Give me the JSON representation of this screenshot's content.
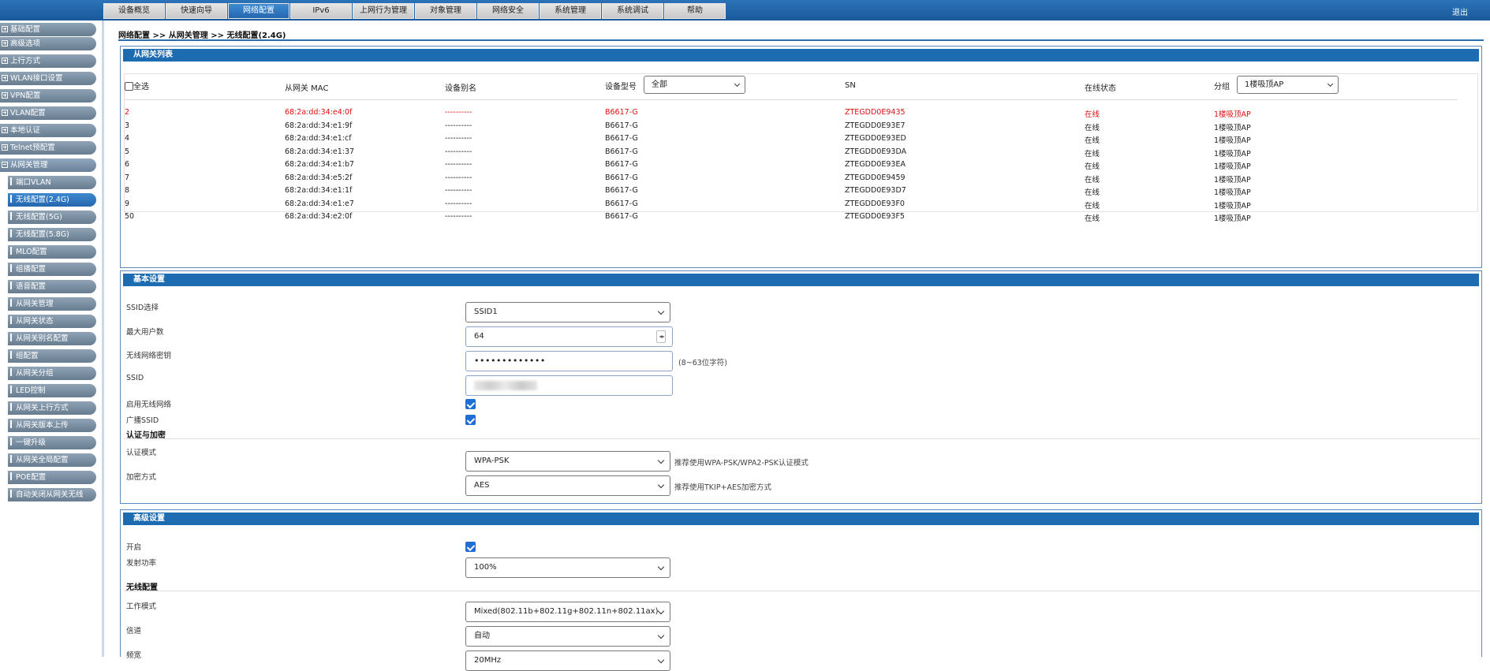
{
  "nav": {
    "tabs": [
      "设备概览",
      "快速向导",
      "网络配置",
      "IPv6",
      "上网行为管理",
      "对象管理",
      "网络安全",
      "系统管理",
      "系统调试",
      "帮助"
    ],
    "active_index": 2,
    "logout": "退出"
  },
  "sidebar": {
    "groups": [
      "基础配置",
      "高级选项",
      "上行方式",
      "WLAN接口设置",
      "VPN配置",
      "VLAN配置",
      "本地认证",
      "Telnet预配置",
      "从网关管理"
    ],
    "subitems": [
      "端口VLAN",
      "无线配置(2.4G)",
      "无线配置(5G)",
      "无线配置(5.8G)",
      "MLO配置",
      "组播配置",
      "语音配置",
      "从网关管理",
      "从网关状态",
      "从网关别名配置",
      "组配置",
      "从网关分组",
      "LED控制",
      "从网关上行方式",
      "从网关版本上传",
      "一键升级",
      "从网关全局配置",
      "POE配置",
      "自动关闭从网关无线"
    ],
    "current_sub": 1
  },
  "breadcrumb": "网络配置 >> 从网关管理 >> 无线配置(2.4G)",
  "list": {
    "title": "从网关列表",
    "headers": {
      "select_all": "全选",
      "mac": "从网关 MAC",
      "alias": "设备别名",
      "model": "设备型号",
      "sn": "SN",
      "status": "在线状态",
      "group": "分组"
    },
    "model_filter": "全部",
    "group_filter": "1楼吸顶AP",
    "rows": [
      {
        "id": "2",
        "mac": "68:2a:dd:34:e4:0f",
        "alias": "----------",
        "model": "B6617-G",
        "sn": "ZTEGDD0E9435",
        "status": "在线",
        "group": "1楼吸顶AP",
        "highlight": true
      },
      {
        "id": "3",
        "mac": "68:2a:dd:34:e1:9f",
        "alias": "----------",
        "model": "B6617-G",
        "sn": "ZTEGDD0E93E7",
        "status": "在线",
        "group": "1楼吸顶AP"
      },
      {
        "id": "4",
        "mac": "68:2a:dd:34:e1:cf",
        "alias": "----------",
        "model": "B6617-G",
        "sn": "ZTEGDD0E93ED",
        "status": "在线",
        "group": "1楼吸顶AP"
      },
      {
        "id": "5",
        "mac": "68:2a:dd:34:e1:37",
        "alias": "----------",
        "model": "B6617-G",
        "sn": "ZTEGDD0E93DA",
        "status": "在线",
        "group": "1楼吸顶AP"
      },
      {
        "id": "6",
        "mac": "68:2a:dd:34:e1:b7",
        "alias": "----------",
        "model": "B6617-G",
        "sn": "ZTEGDD0E93EA",
        "status": "在线",
        "group": "1楼吸顶AP"
      },
      {
        "id": "7",
        "mac": "68:2a:dd:34:e5:2f",
        "alias": "----------",
        "model": "B6617-G",
        "sn": "ZTEGDD0E9459",
        "status": "在线",
        "group": "1楼吸顶AP"
      },
      {
        "id": "8",
        "mac": "68:2a:dd:34:e1:1f",
        "alias": "----------",
        "model": "B6617-G",
        "sn": "ZTEGDD0E93D7",
        "status": "在线",
        "group": "1楼吸顶AP"
      },
      {
        "id": "9",
        "mac": "68:2a:dd:34:e1:e7",
        "alias": "----------",
        "model": "B6617-G",
        "sn": "ZTEGDD0E93F0",
        "status": "在线",
        "group": "1楼吸顶AP"
      },
      {
        "id": "50",
        "mac": "68:2a:dd:34:e2:0f",
        "alias": "----------",
        "model": "B6617-G",
        "sn": "ZTEGDD0E93F5",
        "status": "在线",
        "group": "1楼吸顶AP"
      }
    ]
  },
  "basic": {
    "title": "基本设置",
    "ssid_select_label": "SSID选择",
    "ssid_select_value": "SSID1",
    "max_users_label": "最大用户数",
    "max_users_value": "64",
    "password_label": "无线网络密钥",
    "password_value": "•••••••••••••",
    "password_hint": "(8~63位字符)",
    "ssid_label": "SSID",
    "enable_label": "启用无线网络",
    "enable_checked": true,
    "broadcast_label": "广播SSID",
    "broadcast_checked": true,
    "auth_section": "认证与加密",
    "auth_mode_label": "认证模式",
    "auth_mode_value": "WPA-PSK",
    "auth_mode_hint": "推荐使用WPA-PSK/WPA2-PSK认证模式",
    "encrypt_label": "加密方式",
    "encrypt_value": "AES",
    "encrypt_hint": "推荐使用TKIP+AES加密方式"
  },
  "advanced": {
    "title": "高级设置",
    "on_label": "开启",
    "on_checked": true,
    "power_label": "发射功率",
    "power_value": "100%",
    "wireless_section": "无线配置",
    "mode_label": "工作模式",
    "mode_value": "Mixed(802.11b+802.11g+802.11n+802.11ax)",
    "channel_label": "信道",
    "channel_value": "自动",
    "bandwidth_label": "频宽",
    "bandwidth_value": "20MHz"
  },
  "colors": {
    "nav_blue": "#1d6bb0",
    "highlight_red": "#d11111",
    "checkbox_blue": "#1f6ed4"
  }
}
